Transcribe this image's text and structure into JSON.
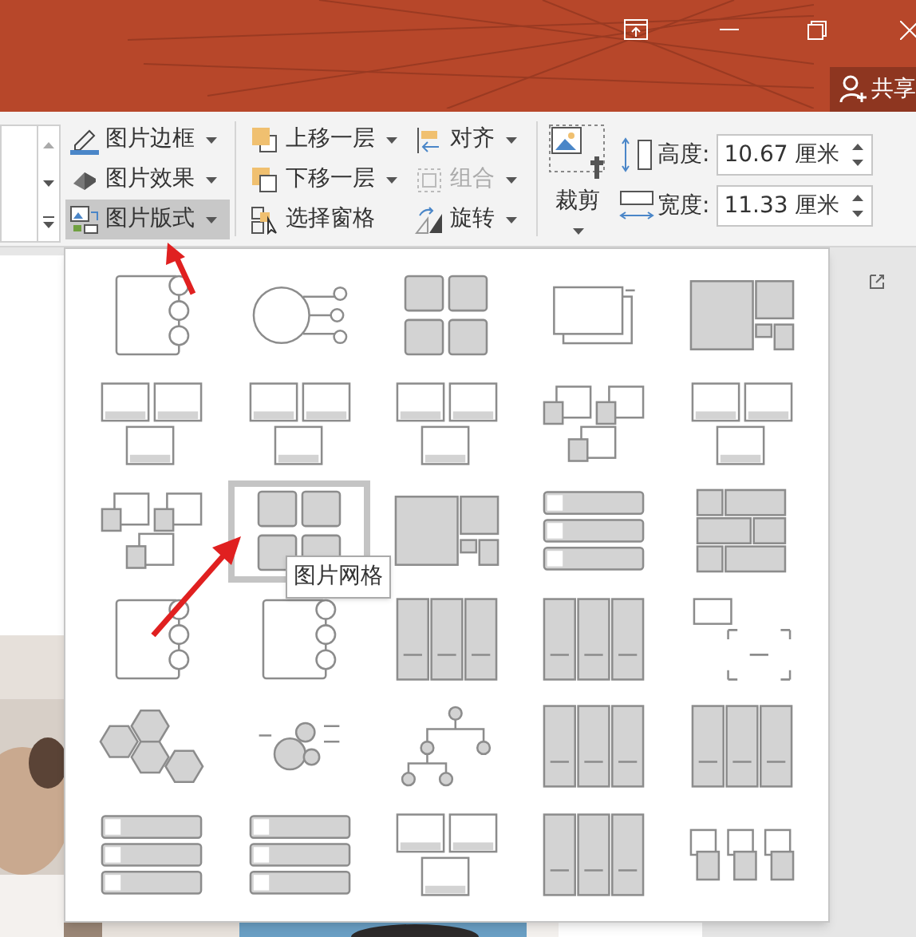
{
  "share_button": {
    "label": "共享"
  },
  "picture_commands": [
    {
      "label": "图片边框",
      "selected": false
    },
    {
      "label": "图片效果",
      "selected": false
    },
    {
      "label": "图片版式",
      "selected": true
    }
  ],
  "arrange_commands": [
    {
      "label": "上移一层",
      "disabled": false
    },
    {
      "label": "下移一层",
      "disabled": false
    },
    {
      "label": "选择窗格",
      "disabled": false
    }
  ],
  "arrange_commands_2": [
    {
      "label": "对齐",
      "disabled": false
    },
    {
      "label": "组合",
      "disabled": true
    },
    {
      "label": "旋转",
      "disabled": false
    }
  ],
  "crop_button": {
    "label": "裁剪"
  },
  "size_fields": [
    {
      "label": "高度:",
      "value": "10.67 厘米"
    },
    {
      "label": "宽度:",
      "value": "11.33 厘米"
    }
  ],
  "layout_gallery": {
    "tooltip": "图片网格",
    "items": [
      {
        "kind": "circles",
        "selected": false
      },
      {
        "kind": "hub",
        "selected": false
      },
      {
        "kind": "grid",
        "selected": false
      },
      {
        "kind": "stack",
        "selected": false
      },
      {
        "kind": "mosaic",
        "selected": false
      },
      {
        "kind": "frames",
        "selected": false
      },
      {
        "kind": "frames",
        "selected": false
      },
      {
        "kind": "frames",
        "selected": false
      },
      {
        "kind": "offset",
        "selected": false
      },
      {
        "kind": "frames",
        "selected": false
      },
      {
        "kind": "offset",
        "selected": false
      },
      {
        "kind": "grid",
        "selected": true
      },
      {
        "kind": "mosaic",
        "selected": false
      },
      {
        "kind": "rows",
        "selected": false
      },
      {
        "kind": "tiles",
        "selected": false
      },
      {
        "kind": "circles",
        "selected": false
      },
      {
        "kind": "circles",
        "selected": false
      },
      {
        "kind": "columns",
        "selected": false
      },
      {
        "kind": "columns",
        "selected": false
      },
      {
        "kind": "corners",
        "selected": false
      },
      {
        "kind": "hex",
        "selected": false
      },
      {
        "kind": "bubbles",
        "selected": false
      },
      {
        "kind": "tree",
        "selected": false
      },
      {
        "kind": "columns",
        "selected": false
      },
      {
        "kind": "columns",
        "selected": false
      },
      {
        "kind": "rows",
        "selected": false
      },
      {
        "kind": "rows",
        "selected": false
      },
      {
        "kind": "frames",
        "selected": false
      },
      {
        "kind": "columns",
        "selected": false
      },
      {
        "kind": "process",
        "selected": false
      }
    ]
  }
}
